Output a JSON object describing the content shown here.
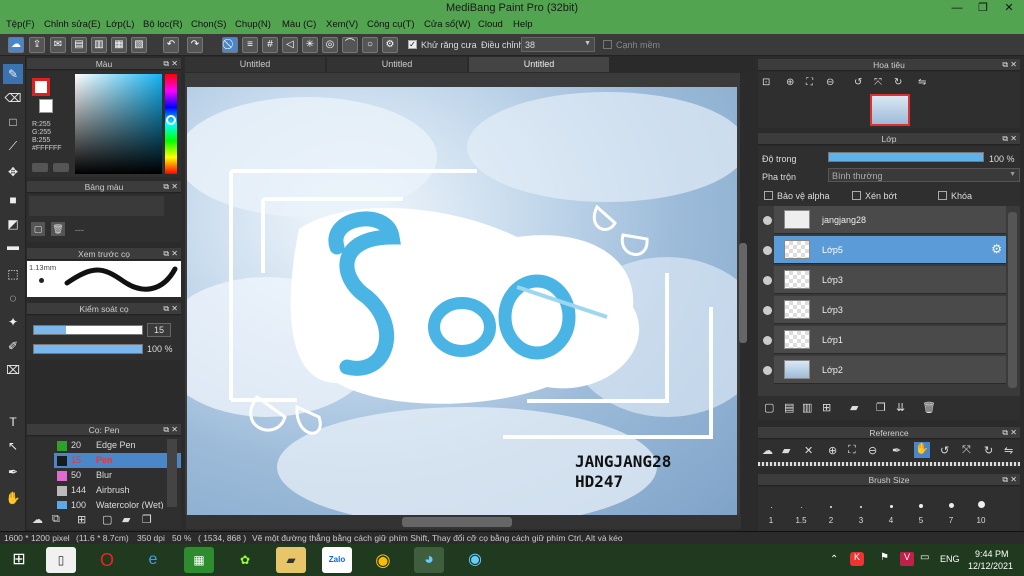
{
  "window": {
    "title": "MediBang Paint Pro (32bit)"
  },
  "menu": [
    "Tệp(F)",
    "Chỉnh sửa(E)",
    "Lớp(L)",
    "Bộ lọc(R)",
    "Chọn(S)",
    "Chụp(N)",
    "Màu (C)",
    "Xem(V)",
    "Công cụ(T)",
    "Cửa sổ(W)",
    "Cloud",
    "Help"
  ],
  "toolbar": {
    "antialias_label": "Khử răng cưa",
    "adjust_label": "Điều chỉnh",
    "adjust_value": "38",
    "smooth_label": "Cạnh mềm"
  },
  "color_panel": {
    "title": "Màu",
    "r": "R:255",
    "g": "G:255",
    "b": "B:255",
    "hex": "#FFFFFF"
  },
  "palette_panel": {
    "title": "Bảng màu",
    "placeholder": "---"
  },
  "brush_preview": {
    "title": "Xem trước cọ",
    "size": "1.13mm"
  },
  "brush_control": {
    "title": "Kiểm soát cọ",
    "size_value": "15",
    "opacity_value": "100 %"
  },
  "brush_panel": {
    "title": "Cọ: Pen",
    "items": [
      {
        "num": "20",
        "label": "Edge Pen",
        "color": "#2ea02e"
      },
      {
        "num": "15",
        "label": "Pen",
        "color": "#1a1a1a",
        "selected": true
      },
      {
        "num": "50",
        "label": "Blur",
        "color": "#e06ad0"
      },
      {
        "num": "144",
        "label": "Airbrush",
        "color": "#bbbbbb"
      },
      {
        "num": "100",
        "label": "Watercolor (Wet)",
        "color": "#5fa8e8"
      }
    ]
  },
  "tabs": [
    "Untitled",
    "Untitled",
    "Untitled"
  ],
  "canvas": {
    "text1": "JANGJANG28",
    "text2": "HD247",
    "logo": "Seo"
  },
  "navigator": {
    "title": "Hoa tiêu"
  },
  "layer_panel": {
    "title": "Lớp",
    "opacity_label": "Độ trong",
    "opacity_value": "100 %",
    "opacity_percent": 100,
    "blend_label": "Pha trộn",
    "blend_value": "Bình thường",
    "protect_alpha": "Bảo vệ alpha",
    "clipping": "Xén bớt",
    "lock": "Khóa",
    "layers": [
      {
        "name": "jangjang28"
      },
      {
        "name": "Lớp5",
        "selected": true
      },
      {
        "name": "Lớp3"
      },
      {
        "name": "Lớp3"
      },
      {
        "name": "Lớp1"
      },
      {
        "name": "Lớp2"
      }
    ]
  },
  "reference_panel": {
    "title": "Reference"
  },
  "brush_size_panel": {
    "title": "Brush Size",
    "sizes": [
      "1",
      "1.5",
      "2",
      "3",
      "4",
      "5",
      "7",
      "10"
    ]
  },
  "status": {
    "size": "1600 * 1200 pixel",
    "physical": "(11.6 * 8.7cm)",
    "dpi": "350 dpi",
    "zoom": "50 %",
    "coords": "( 1534, 868 )",
    "hint": "Vẽ một đường thẳng bằng cách giữ phím Shift, Thay đổi cỡ cọ bằng cách giữ phím Ctrl, Alt và kéo"
  },
  "taskbar": {
    "lang": "ENG",
    "time": "9:44 PM",
    "date": "12/12/2021",
    "zalo": "Zalo"
  }
}
